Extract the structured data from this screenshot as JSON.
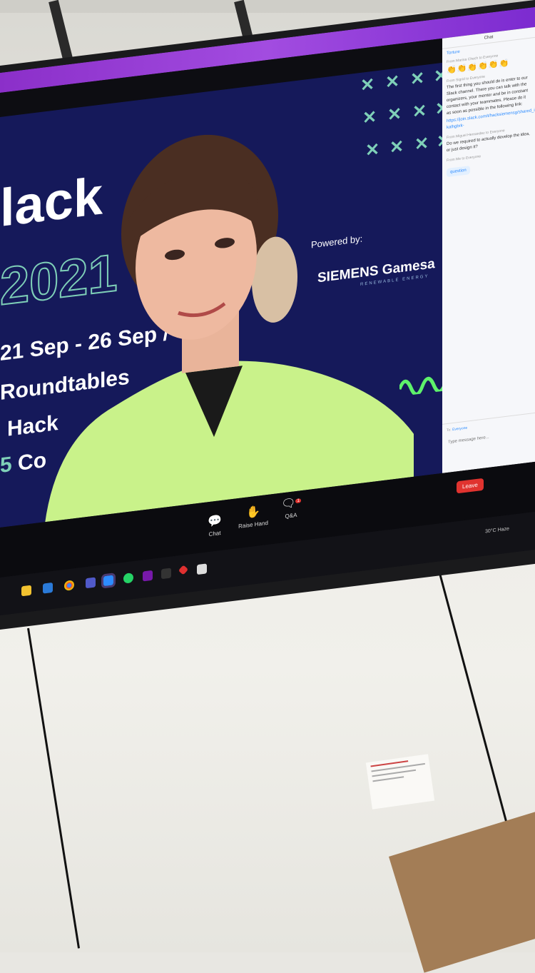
{
  "slide": {
    "title_partial": "lack",
    "year": "2021",
    "dates": "21 Sep - 26 Sep /",
    "line1": "Roundtables",
    "line2": "Hack",
    "line3_prefix": "5",
    "line3": "Co",
    "powered_by": "Powered by:",
    "sponsor_logo": "SIEMENS Gamesa",
    "sponsor_sub": "RENEWABLE ENERGY"
  },
  "controls": {
    "chat": "Chat",
    "raise_hand": "Raise Hand",
    "qa": "Q&A",
    "qa_badge": "1",
    "leave": "Leave"
  },
  "chat_panel": {
    "header": "Chat",
    "to_label": "Torture",
    "messages": [
      {
        "from": "From Marina Chech to Everyone",
        "body": "",
        "emoji": "👏👏👏👏👏👏"
      },
      {
        "from": "From Sigrid to Everyone",
        "body": "The first thing you should do is enter to our Slack channel. There you can talk with the organizers, your mentor and be in constant contact with your teammates. Please do it as soon as possible in the following link:",
        "link": "https://join.slack.com/t/hacksiemensg/shared_invite/zt-kalhgbrk-"
      },
      {
        "from": "From Miguel Hernandez to Everyone",
        "body": "Do we required to actually develop the idea, or just design it?"
      },
      {
        "from": "From Me to Everyone",
        "bubble": "question"
      }
    ],
    "input_to": "Everyone",
    "input_placeholder": "Type message here..."
  },
  "taskbar": {
    "weather": "30°C Haze",
    "icons": [
      "folder-icon",
      "edge-icon",
      "chrome-icon",
      "teams-icon",
      "zoom-icon",
      "whatsapp-icon",
      "onenote-icon",
      "terminal-icon",
      "app-red-icon",
      "printer-icon"
    ]
  },
  "colors": {
    "slide_bg": "#15195a",
    "purple_bar": "#a24ce0",
    "accent_green": "#7fd0b8",
    "wave_green": "#5ef26b",
    "leave_red": "#e0332f",
    "shirt": "#c9f28a"
  }
}
